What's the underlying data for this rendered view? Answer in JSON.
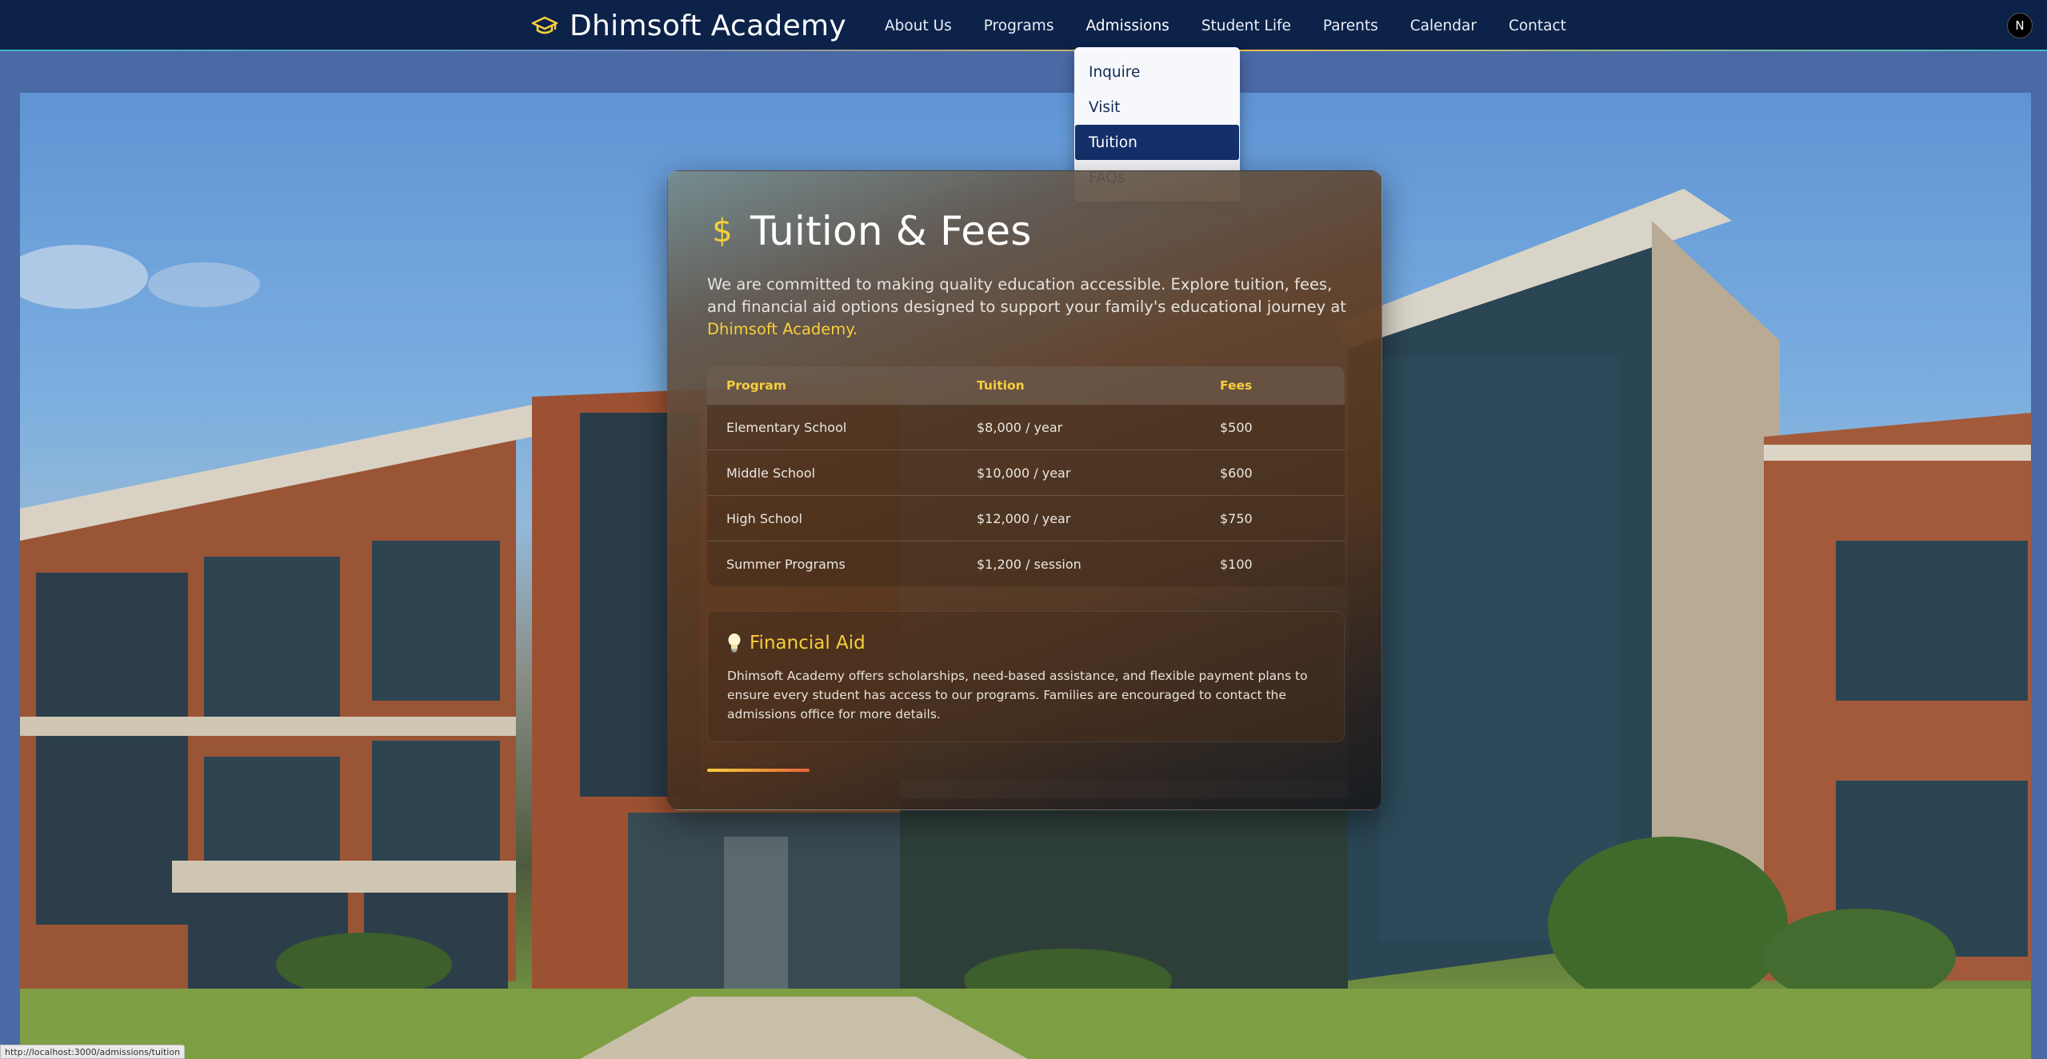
{
  "brand": {
    "name": "Dhimsoft Academy",
    "icon": "graduation-cap-icon"
  },
  "nav": {
    "links": [
      "About Us",
      "Programs",
      "Admissions",
      "Student Life",
      "Parents",
      "Calendar",
      "Contact"
    ],
    "active": "Admissions"
  },
  "user_badge": "N",
  "dropdown": {
    "items": [
      "Inquire",
      "Visit",
      "Tuition",
      "FAQs"
    ],
    "selected": "Tuition"
  },
  "page": {
    "title": "Tuition & Fees",
    "title_icon": "dollar-icon",
    "intro_text": "We are committed to making quality education accessible. Explore tuition, fees, and financial aid options designed to support your family's educational journey at ",
    "intro_highlight": "Dhimsoft Academy."
  },
  "fees_table": {
    "headers": [
      "Program",
      "Tuition",
      "Fees"
    ],
    "rows": [
      [
        "Elementary School",
        "$8,000 / year",
        "$500"
      ],
      [
        "Middle School",
        "$10,000 / year",
        "$600"
      ],
      [
        "High School",
        "$12,000 / year",
        "$750"
      ],
      [
        "Summer Programs",
        "$1,200 / session",
        "$100"
      ]
    ]
  },
  "financial_aid": {
    "icon": "lightbulb-icon",
    "title": "Financial Aid",
    "text": "Dhimsoft Academy offers scholarships, need-based assistance, and flexible payment plans to ensure every student has access to our programs. Families are encouraged to contact the admissions office for more details."
  },
  "status_url": "http://localhost:3000/admissions/tuition",
  "colors": {
    "nav_bg": "#0c2249",
    "accent_gold": "#f6cf3c",
    "dropdown_selected": "#13306a"
  }
}
